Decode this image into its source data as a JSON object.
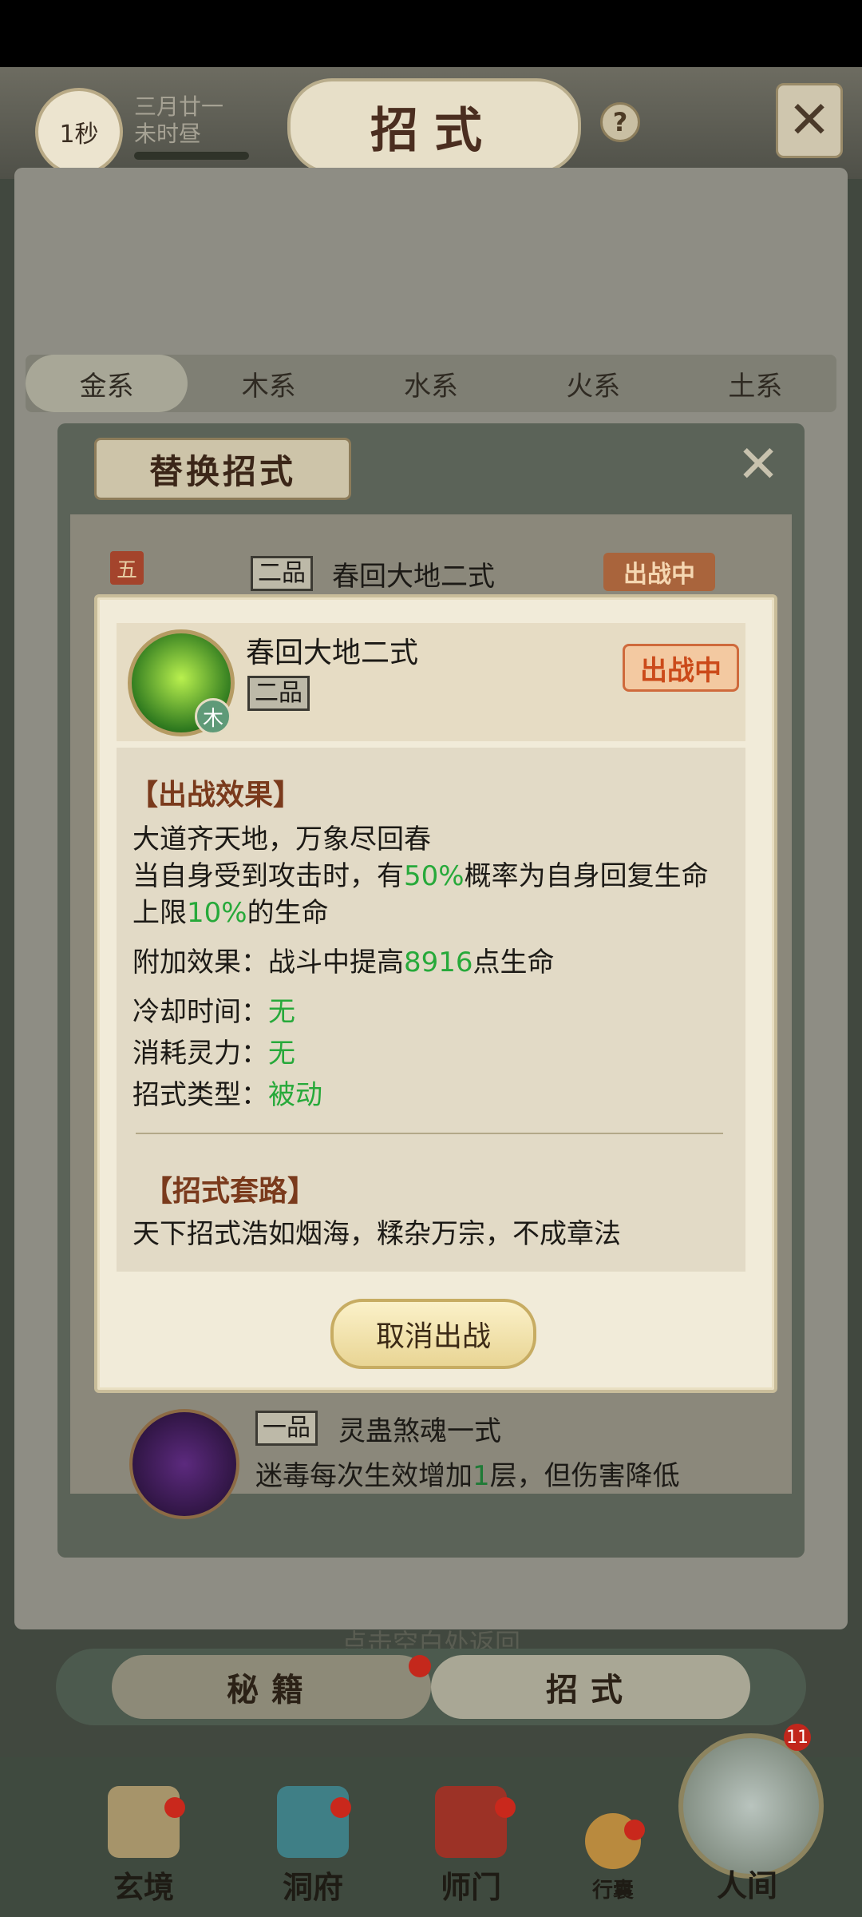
{
  "header": {
    "time_label": "1秒",
    "date_line1": "三月廿一",
    "date_line2": "未时昼",
    "title": "招式",
    "help": "?"
  },
  "element_tabs": [
    {
      "label": "金系",
      "active": true
    },
    {
      "label": "木系",
      "active": false
    },
    {
      "label": "水系",
      "active": false
    },
    {
      "label": "火系",
      "active": false
    },
    {
      "label": "土系",
      "active": false
    }
  ],
  "replace_panel": {
    "title": "替换招式",
    "top_item": {
      "tier": "五",
      "rank": "二品",
      "name": "春回大地二式",
      "badge": "出战中"
    },
    "bottom_item": {
      "rank": "一品",
      "name": "灵蛊煞魂一式",
      "desc_pre": "迷毒每次生效增加",
      "desc_num": "1",
      "desc_post": "层，但伤害降低"
    }
  },
  "detail": {
    "name": "春回大地二式",
    "rank": "二品",
    "element": "木",
    "badge": "出战中",
    "effect_heading": "【出战效果】",
    "effect_line1": "大道齐天地，万象尽回春",
    "effect_line2_pre": "当自身受到攻击时，有",
    "effect_line2_num": "50%",
    "effect_line2_post": "概率为自身回复生命",
    "effect_line3_pre": "上限",
    "effect_line3_num": "10%",
    "effect_line3_post": "的生命",
    "extra_pre": "附加效果：战斗中提高",
    "extra_num": "8916",
    "extra_post": "点生命",
    "cooldown_label": "冷却时间：",
    "cooldown_value": "无",
    "cost_label": "消耗灵力：",
    "cost_value": "无",
    "type_label": "招式类型：",
    "type_value": "被动",
    "routine_heading": "【招式套路】",
    "routine_text": "天下招式浩如烟海，糅杂万宗，不成章法",
    "cancel_button": "取消出战"
  },
  "hint": "点击空白处返回",
  "sub_tabs": {
    "mijie": "秘籍",
    "zhaoshi": "招式"
  },
  "nav": [
    {
      "label": "玄境"
    },
    {
      "label": "洞府"
    },
    {
      "label": "师门"
    },
    {
      "label": "行囊"
    },
    {
      "label": "人间"
    }
  ],
  "world_badge_count": "11",
  "colors": {
    "highlight": "#27a93a",
    "badge": "#cb4a1a",
    "heading": "#7a3a1c"
  }
}
